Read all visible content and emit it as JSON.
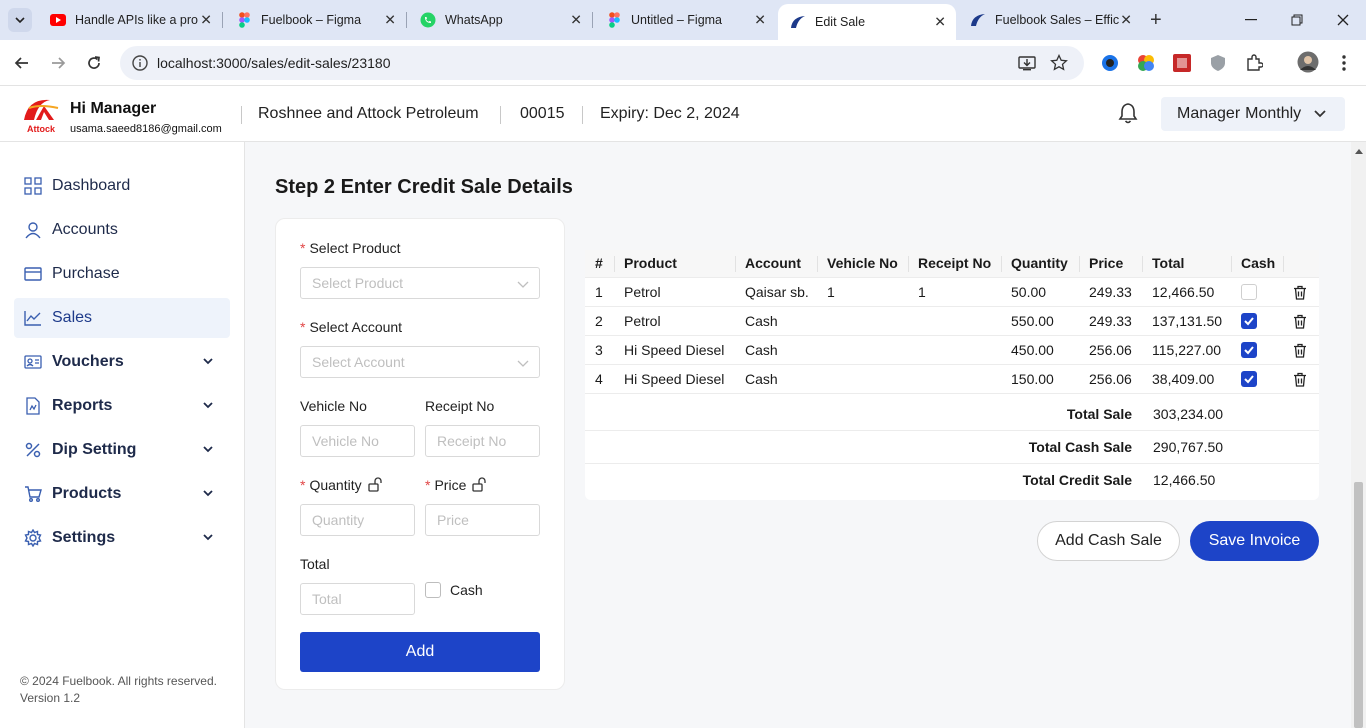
{
  "browser": {
    "tabs": [
      {
        "title": "Handle APIs like a pro",
        "icon": "youtube-icon"
      },
      {
        "title": "Fuelbook – Figma",
        "icon": "figma-icon"
      },
      {
        "title": "WhatsApp",
        "icon": "whatsapp-icon"
      },
      {
        "title": "Untitled – Figma",
        "icon": "figma-icon"
      },
      {
        "title": "Edit Sale",
        "icon": "fuelbook-icon",
        "active": true
      },
      {
        "title": "Fuelbook Sales – Effic",
        "icon": "fuelbook-icon"
      }
    ],
    "url": "localhost:3000/sales/edit-sales/23180"
  },
  "header": {
    "logo_text": "Attock",
    "greeting": "Hi Manager",
    "email": "usama.saeed8186@gmail.com",
    "station": "Roshnee and Attock Petroleum",
    "code": "00015",
    "expiry": "Expiry: Dec 2, 2024",
    "role": "Manager",
    "plan": "Monthly"
  },
  "sidebar": {
    "items": [
      {
        "label": "Dashboard",
        "icon": "dashboard-icon"
      },
      {
        "label": "Accounts",
        "icon": "user-icon"
      },
      {
        "label": "Purchase",
        "icon": "card-icon"
      },
      {
        "label": "Sales",
        "icon": "chart-line-icon",
        "active": true
      },
      {
        "label": "Vouchers",
        "icon": "voucher-icon",
        "expandable": true
      },
      {
        "label": "Reports",
        "icon": "report-icon",
        "expandable": true
      },
      {
        "label": "Dip Setting",
        "icon": "percent-icon",
        "expandable": true
      },
      {
        "label": "Products",
        "icon": "cart-icon",
        "expandable": true
      },
      {
        "label": "Settings",
        "icon": "gear-icon",
        "expandable": true
      }
    ],
    "copyright": "© 2024 Fuelbook. All rights reserved.",
    "version": "Version 1.2"
  },
  "main": {
    "title": "Step 2 Enter Credit Sale Details",
    "form": {
      "product_label": "Select Product",
      "product_placeholder": "Select Product",
      "account_label": "Select Account",
      "account_placeholder": "Select Account",
      "vehicle_label": "Vehicle No",
      "vehicle_placeholder": "Vehicle No",
      "receipt_label": "Receipt No",
      "receipt_placeholder": "Receipt No",
      "quantity_label": "Quantity",
      "quantity_placeholder": "Quantity",
      "price_label": "Price",
      "price_placeholder": "Price",
      "total_label": "Total",
      "total_placeholder": "Total",
      "cash_label": "Cash",
      "add_label": "Add"
    },
    "table": {
      "columns": [
        "#",
        "Product",
        "Account",
        "Vehicle No",
        "Receipt No",
        "Quantity",
        "Price",
        "Total",
        "Cash"
      ],
      "rows": [
        {
          "n": "1",
          "product": "Petrol",
          "account": "Qaisar sb.",
          "vehicle": "1",
          "receipt": "1",
          "quantity": "50.00",
          "price": "249.33",
          "total": "12,466.50",
          "cash": false
        },
        {
          "n": "2",
          "product": "Petrol",
          "account": "Cash",
          "vehicle": "",
          "receipt": "",
          "quantity": "550.00",
          "price": "249.33",
          "total": "137,131.50",
          "cash": true
        },
        {
          "n": "3",
          "product": "Hi Speed Diesel",
          "account": "Cash",
          "vehicle": "",
          "receipt": "",
          "quantity": "450.00",
          "price": "256.06",
          "total": "115,227.00",
          "cash": true
        },
        {
          "n": "4",
          "product": "Hi Speed Diesel",
          "account": "Cash",
          "vehicle": "",
          "receipt": "",
          "quantity": "150.00",
          "price": "256.06",
          "total": "38,409.00",
          "cash": true
        }
      ]
    },
    "summary": {
      "total_sale_label": "Total Sale",
      "total_sale": "303,234.00",
      "total_cash_label": "Total Cash Sale",
      "total_cash": "290,767.50",
      "total_credit_label": "Total Credit Sale",
      "total_credit": "12,466.50"
    },
    "buttons": {
      "add_cash_sale": "Add Cash Sale",
      "save_invoice": "Save Invoice"
    }
  },
  "colors": {
    "accent": "#1d44c8",
    "required": "#e14646",
    "active_bg": "#eef3fb"
  }
}
